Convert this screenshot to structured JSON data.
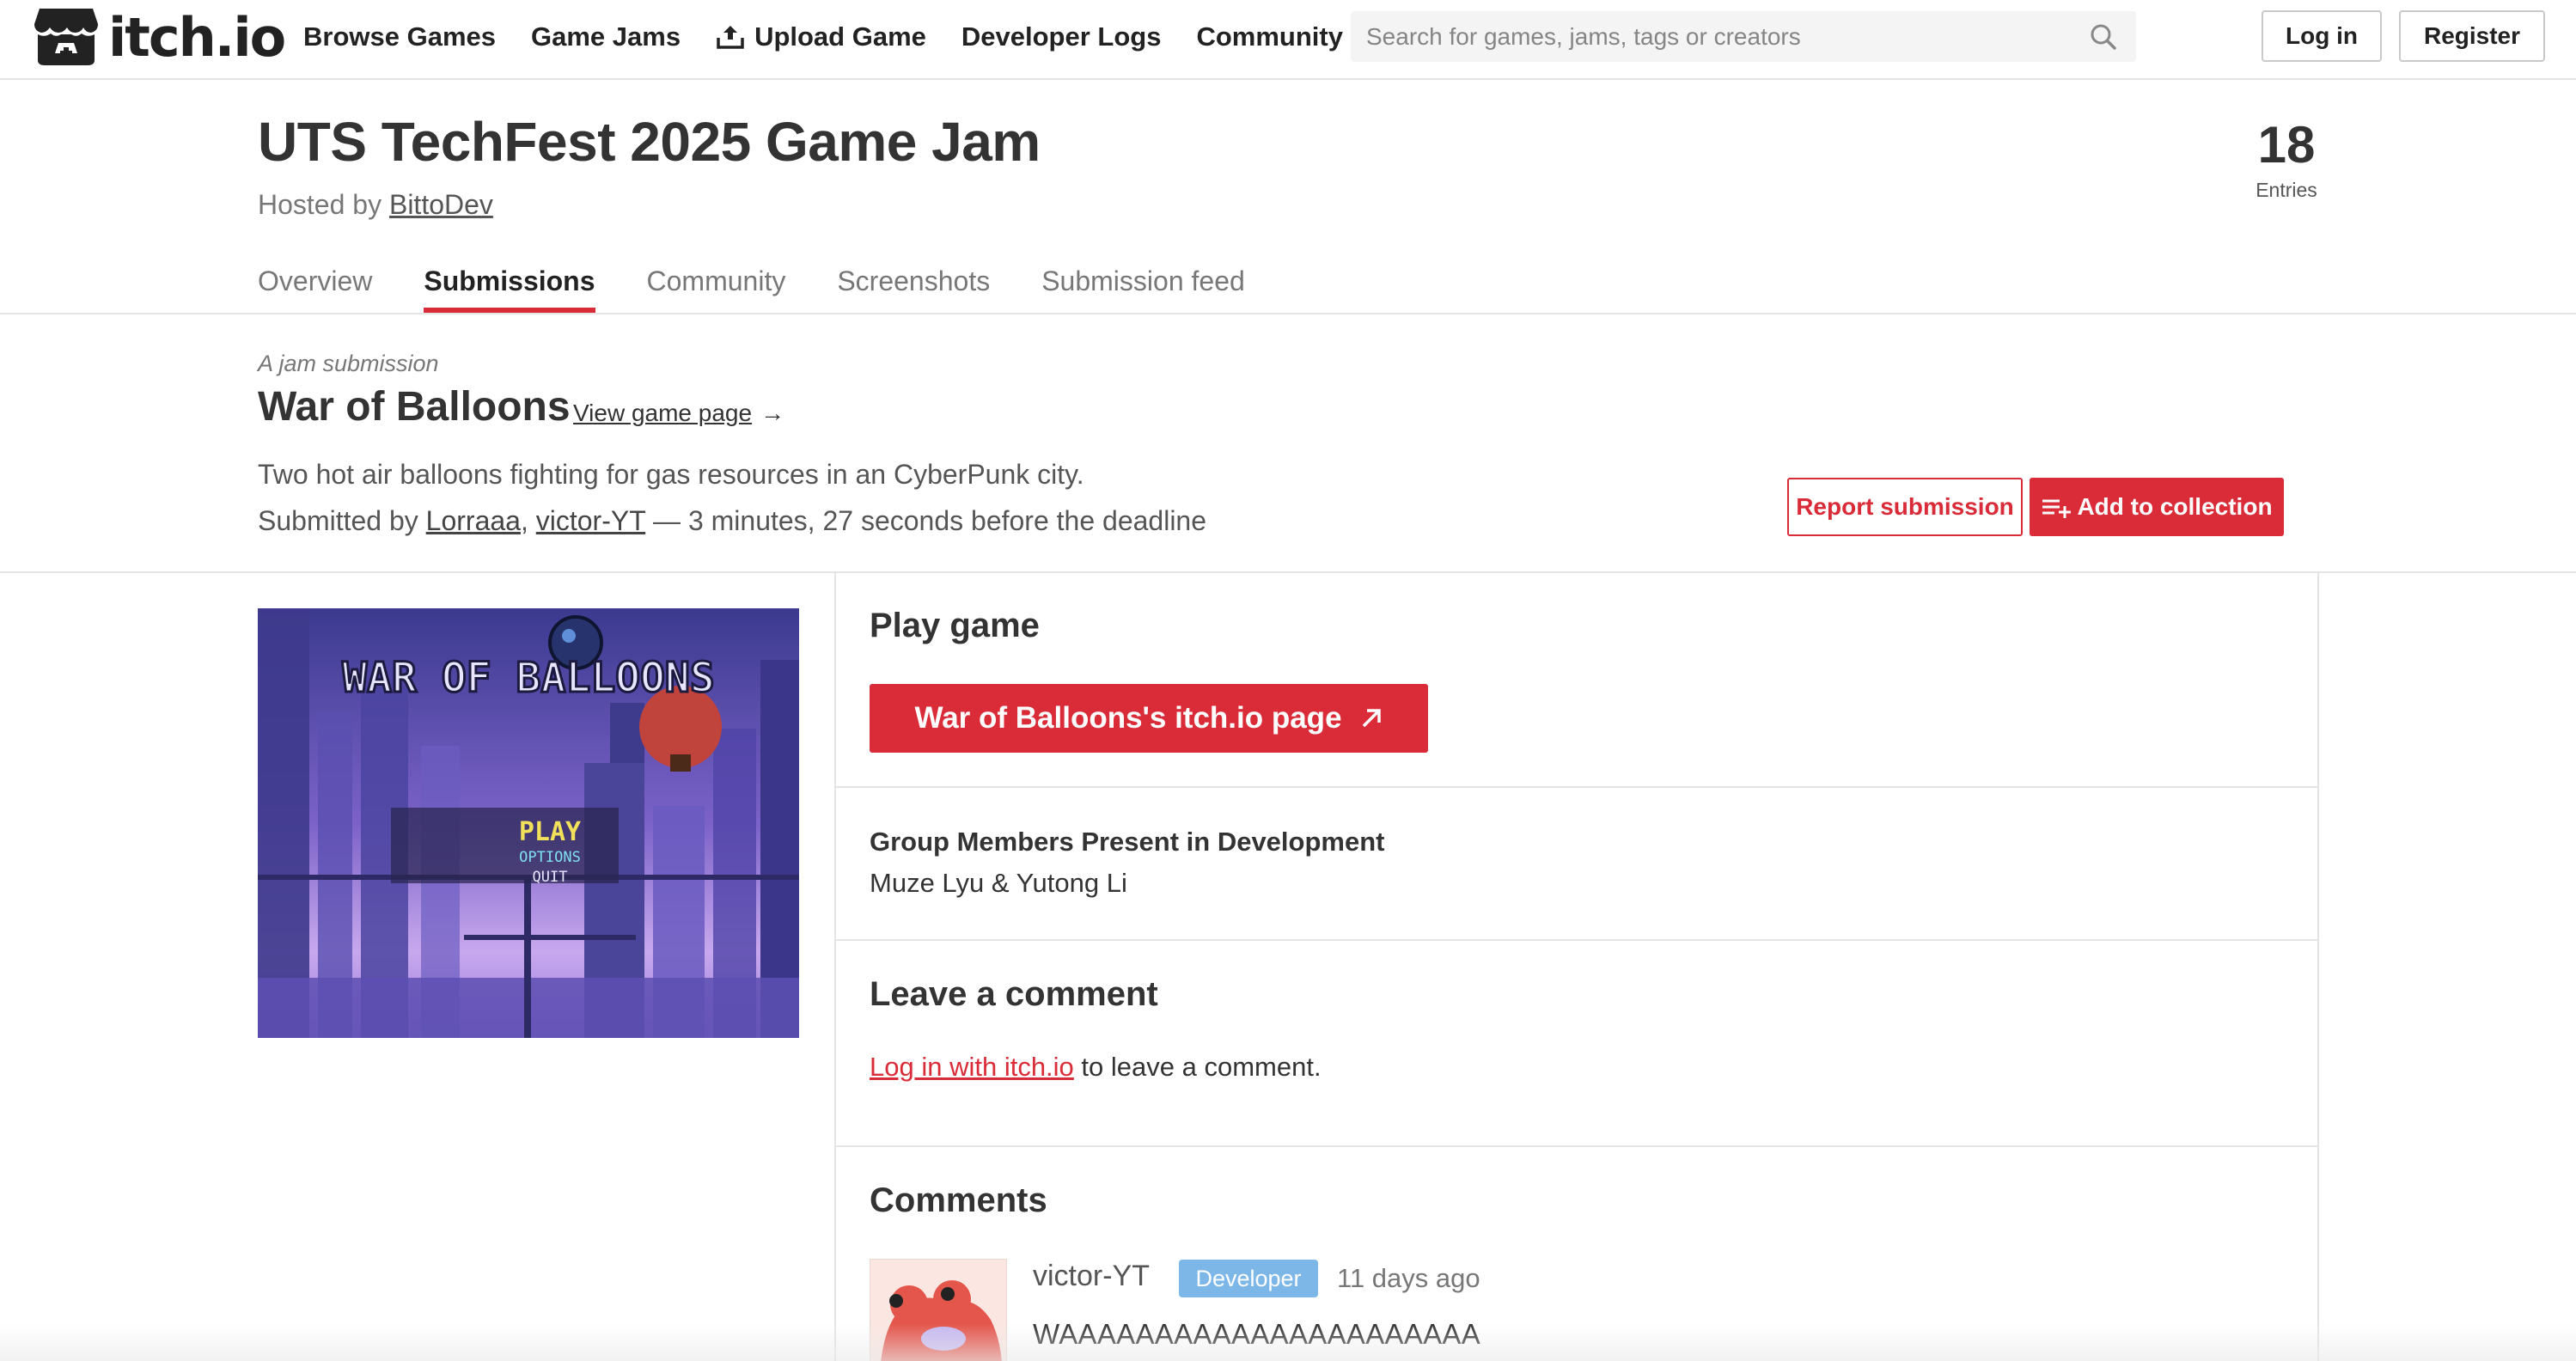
{
  "site": {
    "logo_text": "itch.io",
    "accent_color": "#da2c38",
    "badge_color": "#7cb7e8"
  },
  "nav": {
    "items": [
      {
        "label": "Browse Games"
      },
      {
        "label": "Game Jams"
      },
      {
        "label": "Upload Game",
        "icon": "upload-icon"
      },
      {
        "label": "Developer Logs"
      },
      {
        "label": "Community"
      }
    ]
  },
  "search": {
    "placeholder": "Search for games, jams, tags or creators",
    "icon": "search-icon"
  },
  "auth": {
    "login": "Log in",
    "register": "Register"
  },
  "jam": {
    "title": "UTS TechFest 2025 Game Jam",
    "hosted_prefix": "Hosted by",
    "host": "BittoDev",
    "entries_count": "18",
    "entries_label": "Entries",
    "tabs": [
      {
        "label": "Overview",
        "active": false
      },
      {
        "label": "Submissions",
        "active": true
      },
      {
        "label": "Community",
        "active": false
      },
      {
        "label": "Screenshots",
        "active": false
      },
      {
        "label": "Submission feed",
        "active": false
      }
    ]
  },
  "submission": {
    "kicker": "A jam submission",
    "title": "War of Balloons",
    "view_link": "View game page",
    "view_arrow": "→",
    "description": "Two hot air balloons fighting for gas resources in an CyberPunk city.",
    "submitted_prefix": "Submitted by",
    "authors": [
      "Lorraaa",
      "victor-YT"
    ],
    "author_sep": ",",
    "deadline_text": "— 3 minutes, 27 seconds before the deadline",
    "report_button": "Report submission",
    "collection_button": "Add to collection"
  },
  "screenshot": {
    "title_text": "WAR OF BALLOONS",
    "menu": [
      "PLAY",
      "OPTIONS",
      "QUIT"
    ]
  },
  "play": {
    "heading": "Play game",
    "button": "War of Balloons's itch.io page"
  },
  "fields": [
    {
      "label": "Group Members Present in Development",
      "value": "Muze Lyu & Yutong Li"
    }
  ],
  "leave_comment": {
    "heading": "Leave a comment",
    "login_link": "Log in with itch.io",
    "login_suffix": " to leave a comment."
  },
  "comments": {
    "heading": "Comments",
    "items": [
      {
        "author": "victor-YT",
        "badge": "Developer",
        "time": "11 days ago",
        "text": "WAAAAAAAAAAAAAAAAAAAAAA"
      }
    ]
  }
}
